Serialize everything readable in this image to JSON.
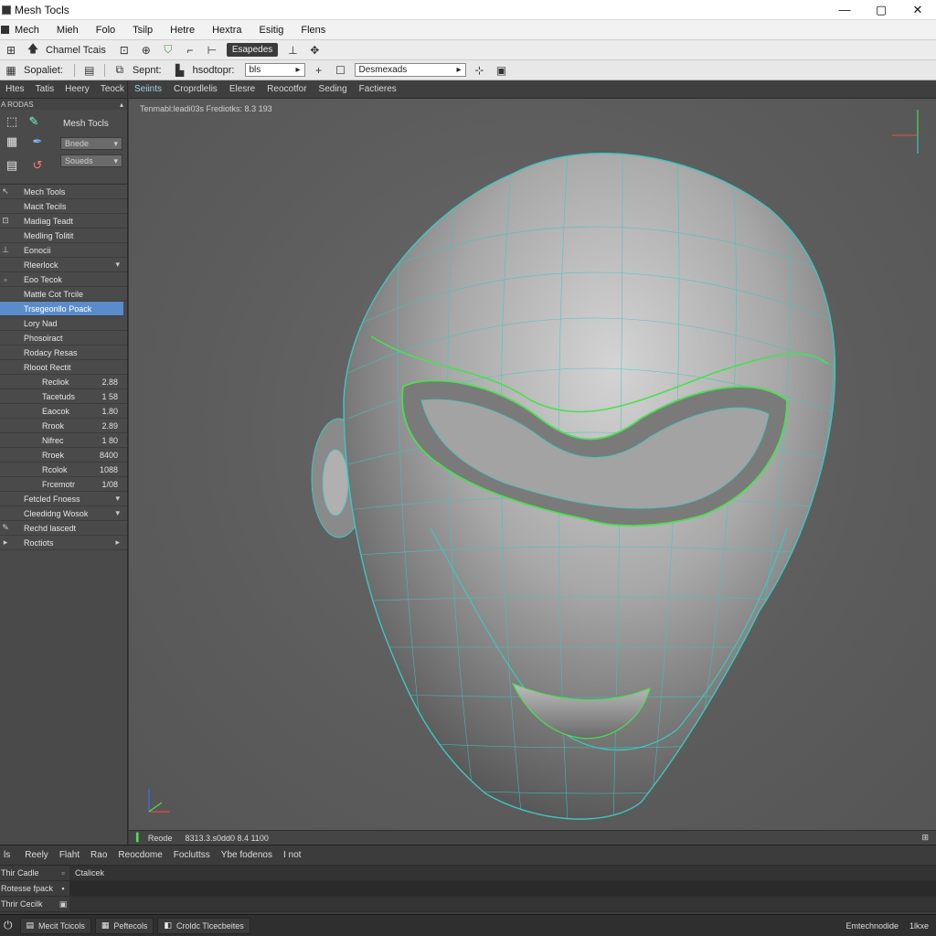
{
  "window": {
    "title": "Mesh Tocls",
    "min": "—",
    "max": "▢",
    "close": "✕"
  },
  "menu": [
    "Mech",
    "Mieh",
    "Folo",
    "Tsilp",
    "Hetre",
    "Hextra",
    "Esitig",
    "Flens"
  ],
  "toolbar1": {
    "label": "Chamel Tcais",
    "pill": "Esapedes"
  },
  "toolbar2": {
    "label1": "Sopaliet:",
    "label2": "Sepnt:",
    "label3": "hsodtopr:",
    "combo1": "bls",
    "combo2": "Desmexads"
  },
  "left_panel": {
    "tabs": [
      "Htes",
      "Tatis",
      "Heery",
      "Teock"
    ],
    "header": "A RODAS",
    "mesh_tools_label": "Mesh Tocls",
    "combo_a": "Bnede",
    "combo_b": "Soueds",
    "rows": [
      {
        "label": "Mech Tools",
        "value": ""
      },
      {
        "label": "Macit Tecils",
        "value": ""
      },
      {
        "label": "Madiag Teadt",
        "value": ""
      },
      {
        "label": "Medling Tolitit",
        "value": ""
      },
      {
        "label": "Eonocii",
        "value": ""
      },
      {
        "label": "Rleerlock",
        "value": ""
      },
      {
        "label": "Eoo Tecok",
        "value": ""
      },
      {
        "label": "Mattle Cot Trcile",
        "value": ""
      },
      {
        "label": "Trsegeonllo Poack",
        "value": ""
      },
      {
        "label": "Lory Nad",
        "value": ""
      },
      {
        "label": "Phosoiract",
        "value": ""
      },
      {
        "label": "Rodacy Resas",
        "value": ""
      },
      {
        "label": "Rlooot Rectit",
        "value": ""
      },
      {
        "label": "Recliok",
        "value": "2.88"
      },
      {
        "label": "Tacetuds",
        "value": "1 58"
      },
      {
        "label": "Eaocok",
        "value": "1.80"
      },
      {
        "label": "Rrook",
        "value": "2.89"
      },
      {
        "label": "Nifrec",
        "value": "1 80"
      },
      {
        "label": "Rroek",
        "value": "8400"
      },
      {
        "label": "Rcolok",
        "value": "1088"
      },
      {
        "label": "Frcemotr",
        "value": "1/08"
      },
      {
        "label": "Fetcled Fnoess",
        "value": ""
      },
      {
        "label": "Cleedidng Wosok",
        "value": ""
      },
      {
        "label": "Rechd lascedt",
        "value": ""
      },
      {
        "label": "Roctiots",
        "value": ""
      }
    ]
  },
  "viewport": {
    "tabs": [
      "Seiints",
      "Croprdlelis",
      "Elesre",
      "Reocotfor",
      "Seding",
      "Factieres"
    ],
    "info": "Tenmabl:leadi03s  Frediotks: 8.3 193",
    "status_label": "Reode",
    "status_value": "8313.3.s0dd0  8.4 1100"
  },
  "timeline": {
    "tabs": [
      "Reely",
      "Flaht",
      "Rao",
      "Reocdome",
      "Focluttss",
      "Ybe fodenos",
      "I not"
    ],
    "rows": [
      {
        "label": "Thir Cadle",
        "rest": "Ctalicek"
      },
      {
        "label": "Rotesse fpack",
        "rest": ""
      },
      {
        "label": "Thrir Cecilk",
        "rest": ""
      }
    ]
  },
  "taskbar": {
    "items": [
      "Mecit Tcicols",
      "Peftecols",
      "Croldc Tlcecbeites"
    ],
    "right_label": "Emtechnodide",
    "right_value": "1lkxe"
  },
  "colors": {
    "accent": "#5a8ccc",
    "wire_cyan": "#3fc6c0",
    "wire_green": "#49e050"
  }
}
